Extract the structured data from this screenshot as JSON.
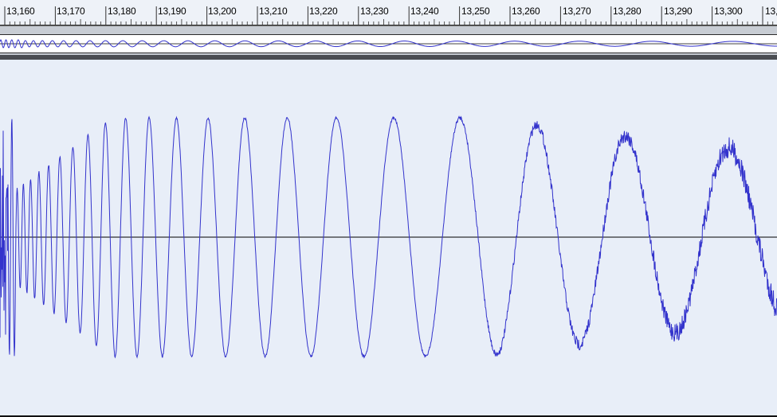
{
  "ruler": {
    "labels": [
      "13,160",
      "13,170",
      "13,180",
      "13,190",
      "13,200",
      "13,210",
      "13,220",
      "13,230",
      "13,240",
      "13,250",
      "13,260",
      "13,270",
      "13,280",
      "13,290",
      "13,300",
      "13,"
    ]
  },
  "colors": {
    "waveform": "#3333cc",
    "background": "#e8eef8",
    "zero_line": "#000000"
  }
}
